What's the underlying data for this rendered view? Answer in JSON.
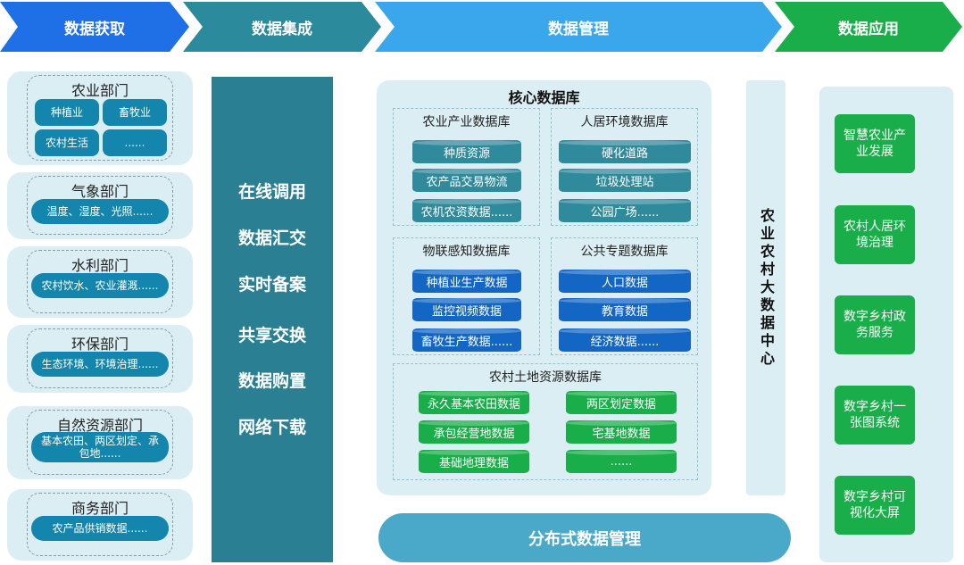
{
  "header": [
    "数据获取",
    "数据集成",
    "数据管理",
    "数据应用"
  ],
  "colors": {
    "acquire": "#1f6fe6",
    "integrate": "#2b8a9c",
    "manage": "#3aa7ec",
    "apply": "#1aae4a",
    "pill": "#1485ad",
    "mid": "#2a7f93",
    "teal_db": "#2f8a9c",
    "blue_db": "#1366c4",
    "green_db": "#1aae4a"
  },
  "departments": [
    {
      "title": "农业部门",
      "items": [
        "种植业",
        "畜牧业",
        "农村生活",
        "......"
      ]
    },
    {
      "title": "气象部门",
      "items": [
        "温度、湿度、光照......"
      ]
    },
    {
      "title": "水利部门",
      "items": [
        "农村饮水、农业灌溉......"
      ]
    },
    {
      "title": "环保部门",
      "items": [
        "生态环境、环境治理......"
      ]
    },
    {
      "title": "自然资源部门",
      "items": [
        "基本农田、两区划定、承包地......"
      ]
    },
    {
      "title": "商务部门",
      "items": [
        "农产品供销数据......"
      ]
    }
  ],
  "integration": [
    "在线调用",
    "数据汇交",
    "实时备案",
    "共享交换",
    "数据购置",
    "网络下载"
  ],
  "core": {
    "title": "核心数据库",
    "dbs": [
      {
        "title": "农业产业数据库",
        "items": [
          "种质资源",
          "农产品交易物流",
          "农机农资数据......"
        ]
      },
      {
        "title": "人居环境数据库",
        "items": [
          "硬化道路",
          "垃圾处理站",
          "公园广场......"
        ]
      },
      {
        "title": "物联感知数据库",
        "items": [
          "种植业生产数据",
          "监控视频数据",
          "畜牧生产数据......"
        ]
      },
      {
        "title": "公共专题数据库",
        "items": [
          "人口数据",
          "教育数据",
          "经济数据......"
        ]
      },
      {
        "title": "农村土地资源数据库",
        "items": [
          "永久基本农田数据",
          "两区划定数据",
          "承包经营地数据",
          "宅基地数据",
          "基础地理数据",
          "......"
        ]
      }
    ]
  },
  "center": "农业农村大数据中心",
  "distributed": "分布式数据管理",
  "applications": [
    "智慧农业产业发展",
    "农村人居环境治理",
    "数字乡村政务服务",
    "数字乡村一张图系统",
    "数字乡村可视化大屏"
  ]
}
